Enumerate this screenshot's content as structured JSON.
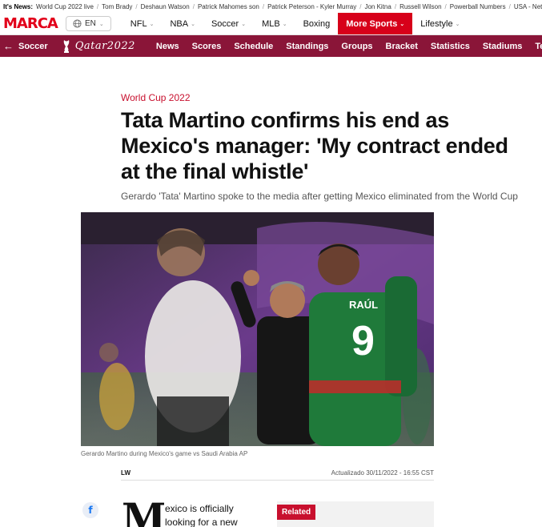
{
  "trending": {
    "label": "It's News:",
    "items": [
      "World Cup 2022 live",
      "Tom Brady",
      "Deshaun Watson",
      "Patrick Mahomes son",
      "Patrick Peterson - Kyler Murray",
      "Jon Kitna",
      "Russell Wilson",
      "Powerball Numbers",
      "USA - Net"
    ]
  },
  "header": {
    "logo": "MARCA",
    "language": "EN",
    "nav": [
      {
        "label": "NFL",
        "active": false
      },
      {
        "label": "NBA",
        "active": false
      },
      {
        "label": "Soccer",
        "active": false
      },
      {
        "label": "MLB",
        "active": false
      },
      {
        "label": "Boxing",
        "active": false
      },
      {
        "label": "More Sports",
        "active": true
      },
      {
        "label": "Lifestyle",
        "active": false
      }
    ]
  },
  "worldcup_bar": {
    "section": "Soccer",
    "brand": "Qatar2022",
    "items": [
      "News",
      "Scores",
      "Schedule",
      "Standings",
      "Groups",
      "Bracket",
      "Statistics",
      "Stadiums",
      "Teams"
    ]
  },
  "article": {
    "kicker": "World Cup 2022",
    "headline": "Tata Martino confirms his end as Mexico's manager: 'My contract ended at the final whistle'",
    "subtitle": "Gerardo 'Tata' Martino spoke to the media after getting Mexico eliminated from the World Cup",
    "caption": "Gerardo Martino during Mexico's game vs Saudi Arabia  AP",
    "author": "LW",
    "updated": "Actualizado 30/11/2022 - 16:55 CST",
    "dropcap": "M",
    "body_start": "exico is officially looking for a new",
    "related_label": "Related",
    "jersey_name": "RAÚL",
    "jersey_number": "9"
  },
  "colors": {
    "brand_red": "#e2001a",
    "wc_maroon": "#8a1538",
    "active_nav": "#d7001a"
  }
}
